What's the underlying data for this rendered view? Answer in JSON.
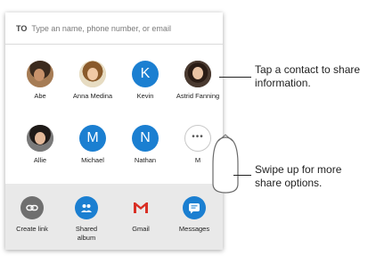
{
  "share_sheet": {
    "to_label": "TO",
    "to_placeholder": "Type an name, phone number, or email",
    "contacts": [
      {
        "name": "Abe",
        "type": "photo"
      },
      {
        "name": "Anna Medina",
        "type": "photo"
      },
      {
        "name": "Kevin",
        "type": "letter",
        "initial": "K"
      },
      {
        "name": "Astrid Fanning",
        "type": "photo"
      },
      {
        "name": "Allie",
        "type": "photo"
      },
      {
        "name": "Michael",
        "type": "letter",
        "initial": "M"
      },
      {
        "name": "Nathan",
        "type": "letter",
        "initial": "N"
      },
      {
        "name": "M",
        "type": "more",
        "initial": "•••"
      }
    ],
    "apps": [
      {
        "label": "Create link",
        "icon": "link-icon",
        "color": "#6f6f6f"
      },
      {
        "label": "Shared album",
        "icon": "people-icon",
        "color": "#1b7fd1"
      },
      {
        "label": "Gmail",
        "icon": "gmail-icon",
        "color": "#ffffff"
      },
      {
        "label": "Messages",
        "icon": "messages-icon",
        "color": "#1b7fd1"
      }
    ]
  },
  "callouts": {
    "contact_tip": "Tap a contact to share information.",
    "swipe_tip": "Swipe up for more share options."
  },
  "colors": {
    "accent": "#1b7fd1",
    "bottom_bar": "#e9e9e9"
  }
}
